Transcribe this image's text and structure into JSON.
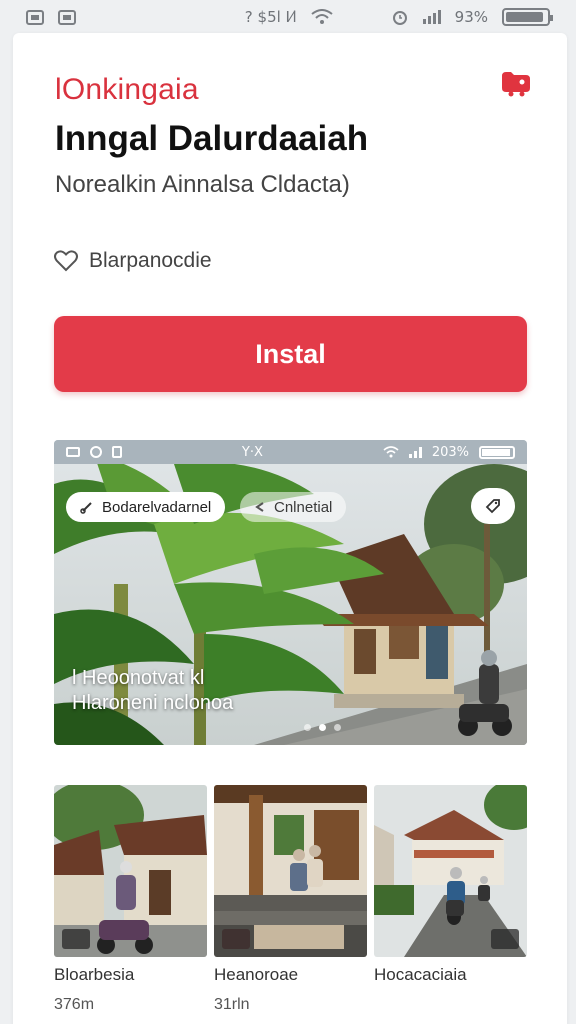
{
  "status_bar": {
    "right_text": "? $5l ⵏ⁄l",
    "battery_text": "93%",
    "battery_level": 0.93
  },
  "app": {
    "brand": "lOnkingaia",
    "title": "Inngal Dalurdaaiah",
    "subtitle": "Norealkin Ainnalsa Cldacta)",
    "favorite_label": "Blarpanocdie",
    "install_label": "Instal"
  },
  "preview": {
    "inner_status": {
      "center_text": "Y·X",
      "battery_text": "203%"
    },
    "chip_1": "Bodarelvadarnel",
    "chip_2": "Cnlnetial",
    "overlay_line_1": "l Heoonotvat kl",
    "overlay_line_2": "Hlaroneni nclonoa",
    "dots": 3,
    "active_dot": 1
  },
  "thumbnails": [
    {
      "name": "Bloarbesia",
      "meta": "376m"
    },
    {
      "name": "Heanoroae",
      "meta": "31rln"
    },
    {
      "name": "Hocacaciaia",
      "meta": ""
    }
  ],
  "colors": {
    "accent": "#e33b49",
    "brand": "#d9323e"
  },
  "icons": {
    "share": "folder-share-icon",
    "favorite": "heart-outline-icon",
    "chip_1": "link-icon",
    "chip_2": "chevron-icon",
    "round": "tag-icon"
  }
}
